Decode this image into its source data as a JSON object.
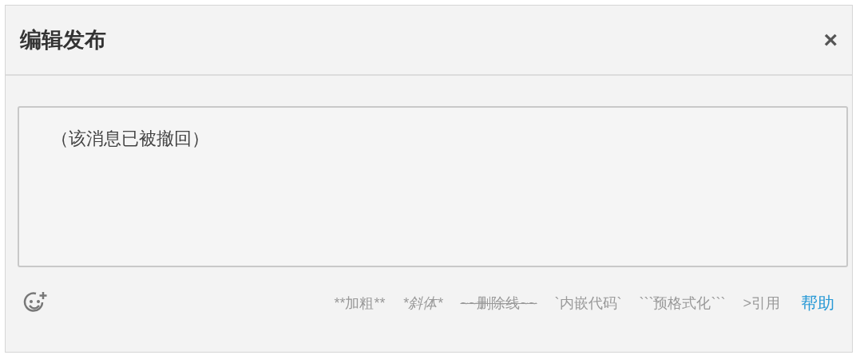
{
  "dialog": {
    "title": "编辑发布",
    "close": "×"
  },
  "editor": {
    "value": "（该消息已被撤回）"
  },
  "format_hints": [
    {
      "kind": "bold",
      "text": "**加粗**"
    },
    {
      "kind": "italic",
      "text": "*斜体*"
    },
    {
      "kind": "strike",
      "text": "~~删除线~~"
    },
    {
      "kind": "code",
      "text": "`内嵌代码`"
    },
    {
      "kind": "pre",
      "text": "```预格式化```"
    },
    {
      "kind": "quote",
      "text": ">引用"
    }
  ],
  "help_link": "帮助"
}
